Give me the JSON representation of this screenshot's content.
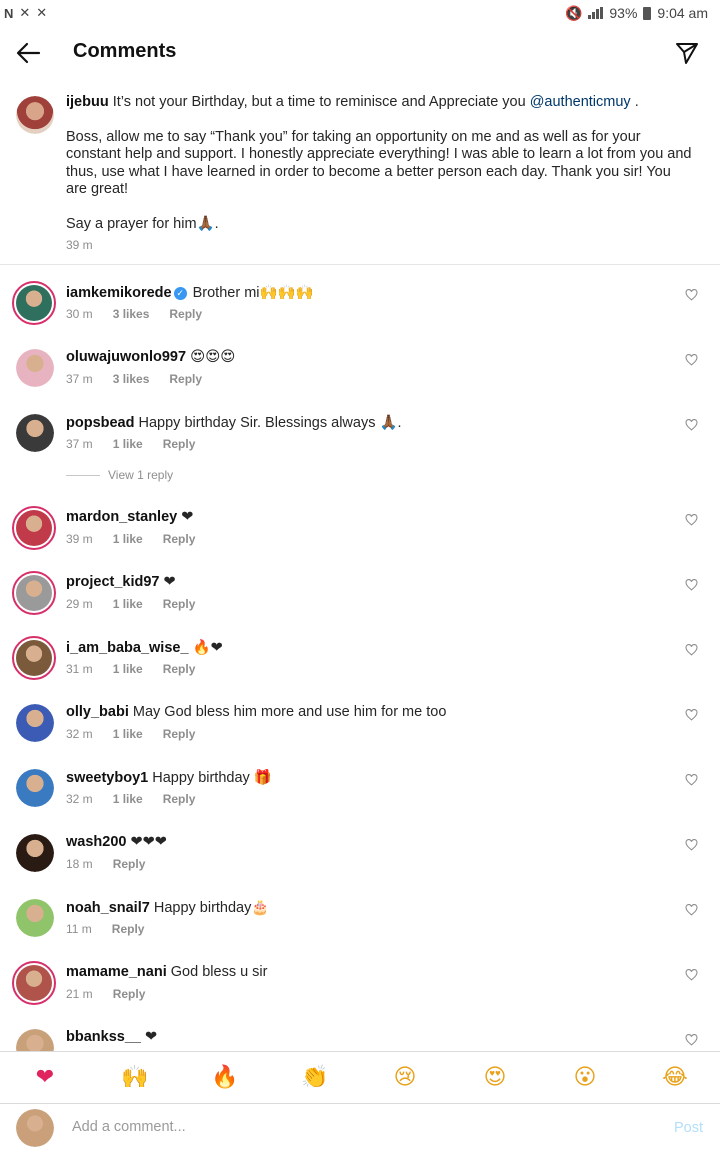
{
  "status_bar": {
    "left_icons": [
      "N",
      "✕",
      "✕"
    ],
    "battery": "93%",
    "time": "9:04 am"
  },
  "header": {
    "title": "Comments",
    "back_icon": "arrow-left-icon",
    "send_icon": "paper-plane-icon"
  },
  "caption": {
    "username": "ijebuu",
    "line1": " It’s not your Birthday, but a time to reminisce and Appreciate you ",
    "mention": "@authenticmuy",
    "line1_end": " .",
    "paragraph2": "Boss, allow me to say “Thank you” for taking an opportunity on me and as well as for your constant help and support. I honestly appreciate everything! I was able to learn a lot from you and thus, use what I have learned in order to become a better person each day. Thank you sir! You are great!",
    "paragraph3": "Say a prayer for him🙏🏾.",
    "time": "39 m"
  },
  "comments": [
    {
      "username": "iamkemikorede",
      "verified": true,
      "text": " Brother mi🙌🙌🙌",
      "time": "30 m",
      "likes": "3 likes",
      "reply": "Reply",
      "avatar_color": "#2f6f5e"
    },
    {
      "username": "oluwajuwonlo997",
      "text": " 😍😍😍",
      "time": "37 m",
      "likes": "3 likes",
      "reply": "Reply",
      "avatar_color": "#e8b3c0"
    },
    {
      "username": "popsbead",
      "text": " Happy birthday Sir. Blessings always 🙏🏾.",
      "time": "37 m",
      "likes": "1 like",
      "reply": "Reply",
      "avatar_color": "#3a3a3a"
    },
    {
      "username": "mardon_stanley",
      "text": " ❤",
      "time": "39 m",
      "likes": "1 like",
      "reply": "Reply",
      "avatar_color": "#c03a4a"
    },
    {
      "username": "project_kid97",
      "text": " ❤",
      "time": "29 m",
      "likes": "1 like",
      "reply": "Reply",
      "avatar_color": "#9a9a9a"
    },
    {
      "username": "i_am_baba_wise_",
      "text": " 🔥❤",
      "time": "31 m",
      "likes": "1 like",
      "reply": "Reply",
      "avatar_color": "#7a5a3a"
    },
    {
      "username": "olly_babi",
      "text": " May God bless him more and use him for me too",
      "time": "32 m",
      "likes": "1 like",
      "reply": "Reply",
      "avatar_color": "#3b5bb5"
    },
    {
      "username": "sweetyboy1",
      "text": " Happy birthday 🎁",
      "time": "32 m",
      "likes": "1 like",
      "reply": "Reply",
      "avatar_color": "#3a7ac0"
    },
    {
      "username": "wash200",
      "text": " ❤❤❤",
      "time": "18 m",
      "likes": "",
      "reply": "Reply",
      "avatar_color": "#2a1a14"
    },
    {
      "username": "noah_snail7",
      "text": " Happy birthday🎂",
      "time": "11 m",
      "likes": "",
      "reply": "Reply",
      "avatar_color": "#8fc46a"
    },
    {
      "username": "mamame_nani",
      "text": " God bless u sir",
      "time": "21 m",
      "likes": "",
      "reply": "Reply",
      "avatar_color": "#b0534a"
    },
    {
      "username": "bbankss__",
      "text": " ❤",
      "time": "",
      "likes": "",
      "reply": "",
      "avatar_color": "#c8a07a"
    }
  ],
  "view_reply": "View 1 reply",
  "emoji_bar": [
    "❤",
    "🙌",
    "🔥",
    "👏",
    "😢",
    "😍",
    "😮",
    "😂"
  ],
  "input": {
    "placeholder": "Add a comment...",
    "post_label": "Post",
    "avatar_color": "#c9a07a"
  }
}
